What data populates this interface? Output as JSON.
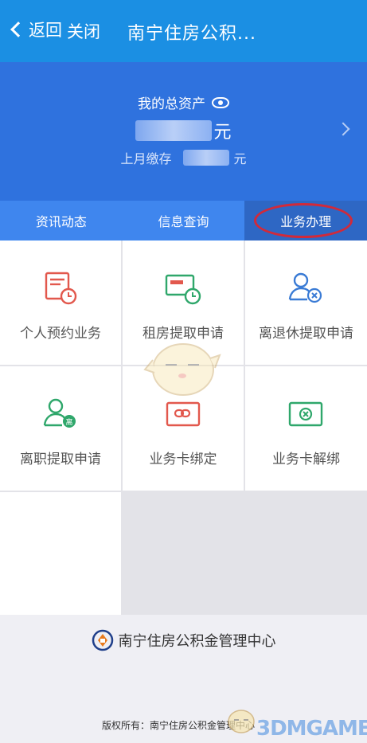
{
  "header": {
    "back_label": "返回",
    "close_label": "关闭",
    "title": "南宁住房公积..."
  },
  "assets": {
    "total_label": "我的总资产",
    "currency": "元",
    "last_month_label": "上月缴存",
    "last_month_currency": "元"
  },
  "tabs": [
    {
      "label": "资讯动态"
    },
    {
      "label": "信息查询"
    },
    {
      "label": "业务办理"
    }
  ],
  "services": [
    {
      "label": "个人预约业务",
      "icon": "calendar-clock-icon"
    },
    {
      "label": "租房提取申请",
      "icon": "card-clock-icon"
    },
    {
      "label": "离退休提取申请",
      "icon": "user-x-icon"
    },
    {
      "label": "离职提取申请",
      "icon": "user-leave-icon"
    },
    {
      "label": "业务卡绑定",
      "icon": "card-link-icon"
    },
    {
      "label": "业务卡解绑",
      "icon": "card-unlink-icon"
    }
  ],
  "footer": {
    "org_name": "南宁住房公积金管理中心",
    "copyright": "版权所有：南宁住房公积金管理中心"
  },
  "watermark": {
    "text": "3DMGAME"
  },
  "colors": {
    "header": "#1b8fe3",
    "asset_bg": "#2f72de",
    "tabs_bg": "#3f86ee",
    "active_tab": "#2e67c4",
    "icon_red": "#e2584d",
    "icon_green": "#2fa76b",
    "icon_blue": "#3a7bd5",
    "highlight": "#d12a3a"
  }
}
